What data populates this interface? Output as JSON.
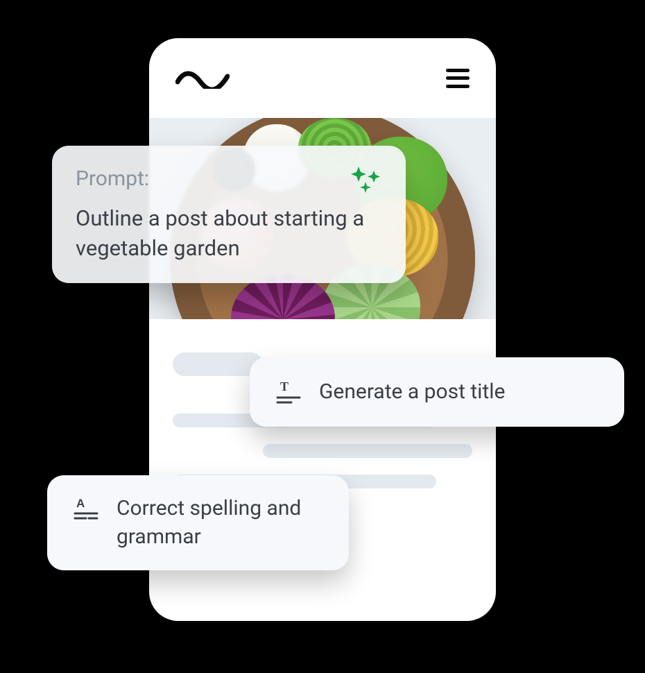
{
  "header": {
    "logo_name": "wave-logo",
    "menu_name": "hamburger-icon"
  },
  "prompt_card": {
    "label": "Prompt:",
    "body": "Outline a post about starting a vegetable garden",
    "ai_icon": "sparkle-icon"
  },
  "suggestions": {
    "generate_title": "Generate a post title",
    "spell_grammar": "Correct spelling and grammar"
  }
}
